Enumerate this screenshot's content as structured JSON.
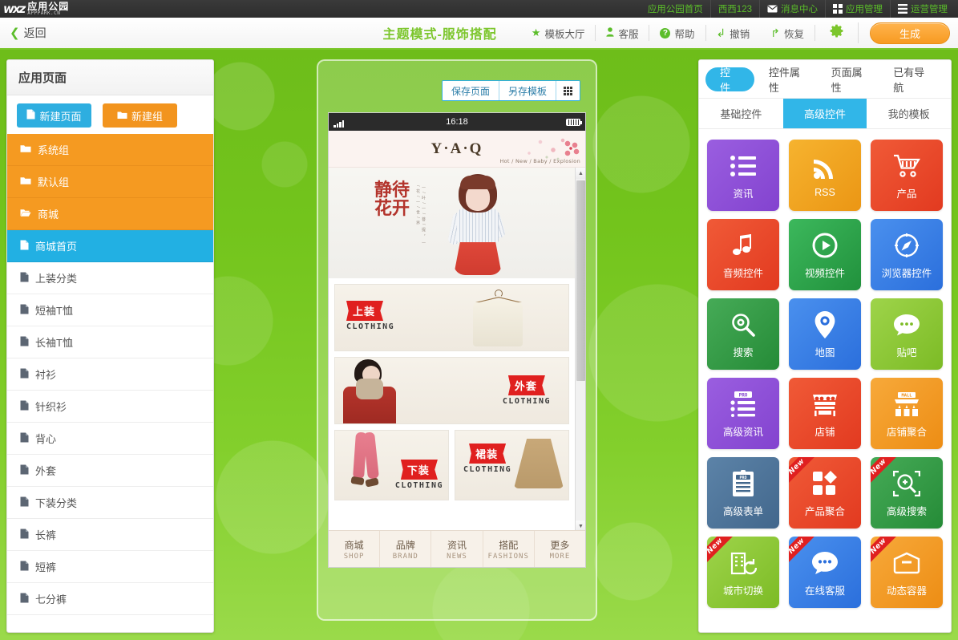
{
  "brand": {
    "mark": "APP",
    "cn": "应用公园",
    "en": "APPPARK.CN"
  },
  "topnav": [
    {
      "label": "应用公园首页",
      "icon": "home-icon"
    },
    {
      "label": "西西123",
      "icon": "user-icon"
    },
    {
      "label": "消息中心",
      "icon": "envelope-icon"
    },
    {
      "label": "应用管理",
      "icon": "grid-icon"
    },
    {
      "label": "运营管理",
      "icon": "list-icon"
    }
  ],
  "toolbar": {
    "back_label": "返回",
    "title": "主题模式-服饰搭配",
    "items": [
      {
        "label": "模板大厅",
        "icon": "star-icon"
      },
      {
        "label": "客服",
        "icon": "user-icon"
      },
      {
        "label": "帮助",
        "icon": "question-icon"
      },
      {
        "label": "撤销",
        "icon": "undo-icon"
      },
      {
        "label": "恢复",
        "icon": "redo-icon"
      }
    ],
    "settings_icon": "gear-icon",
    "generate_label": "生成"
  },
  "sidebar": {
    "title": "应用页面",
    "new_page_label": "新建页面",
    "new_group_label": "新建组",
    "rows": [
      {
        "label": "系统组",
        "type": "group",
        "icon": "folder-icon",
        "active": false
      },
      {
        "label": "默认组",
        "type": "group",
        "icon": "folder-icon",
        "active": false
      },
      {
        "label": "商城",
        "type": "group",
        "icon": "folder-open-icon",
        "active": false
      },
      {
        "label": "商城首页",
        "type": "page",
        "icon": "file-icon",
        "active": true
      },
      {
        "label": "上装分类",
        "type": "page",
        "icon": "file-icon",
        "active": false
      },
      {
        "label": "短袖T恤",
        "type": "page",
        "icon": "file-icon",
        "active": false
      },
      {
        "label": "长袖T恤",
        "type": "page",
        "icon": "file-icon",
        "active": false
      },
      {
        "label": "衬衫",
        "type": "page",
        "icon": "file-icon",
        "active": false
      },
      {
        "label": "针织衫",
        "type": "page",
        "icon": "file-icon",
        "active": false
      },
      {
        "label": "背心",
        "type": "page",
        "icon": "file-icon",
        "active": false
      },
      {
        "label": "外套",
        "type": "page",
        "icon": "file-icon",
        "active": false
      },
      {
        "label": "下装分类",
        "type": "page",
        "icon": "file-icon",
        "active": false
      },
      {
        "label": "长裤",
        "type": "page",
        "icon": "file-icon",
        "active": false
      },
      {
        "label": "短裤",
        "type": "page",
        "icon": "file-icon",
        "active": false
      },
      {
        "label": "七分裤",
        "type": "page",
        "icon": "file-icon",
        "active": false
      }
    ]
  },
  "preview": {
    "save_page_label": "保存页面",
    "save_template_label": "另存模板",
    "qr_icon": "qr-code-icon",
    "status_time": "16:18",
    "app_logo": "Y·A·Q",
    "app_tagline": "Hot / New / Baby / Explosion",
    "hero_title": "静待花开",
    "hero_sub": "一 / 叶 / 一 / 菩 / 提 ， 一 / 花 / 一 / 世 / 界",
    "banners": [
      {
        "tag_cn": "上装",
        "tag_en": "CLOTHING",
        "art": "shirt-hanger",
        "side": "left"
      },
      {
        "tag_cn": "外套",
        "tag_en": "CLOTHING",
        "art": "coat-girl",
        "side": "right"
      }
    ],
    "half_banners": [
      {
        "tag_cn": "下装",
        "tag_en": "CLOTHING",
        "art": "pink-pants",
        "side": "right"
      },
      {
        "tag_cn": "裙装",
        "tag_en": "CLOTHING",
        "art": "khaki-skirt",
        "side": "left"
      }
    ],
    "nav": [
      {
        "cn": "商城",
        "en": "SHOP"
      },
      {
        "cn": "品牌",
        "en": "BRAND"
      },
      {
        "cn": "资讯",
        "en": "NEWS"
      },
      {
        "cn": "搭配",
        "en": "FASHIONS"
      },
      {
        "cn": "更多",
        "en": "MORE"
      }
    ]
  },
  "rightpanel": {
    "tabs": [
      {
        "label": "控件",
        "active": true
      },
      {
        "label": "控件属性",
        "active": false
      },
      {
        "label": "页面属性",
        "active": false
      },
      {
        "label": "已有导航",
        "active": false
      }
    ],
    "subtabs": [
      {
        "label": "基础控件",
        "active": false
      },
      {
        "label": "高级控件",
        "active": true
      },
      {
        "label": "我的模板",
        "active": false
      }
    ],
    "new_badge_label": "New",
    "widgets": [
      {
        "label": "资讯",
        "icon": "news-list-icon",
        "color": "#8b4fd4",
        "new": false
      },
      {
        "label": "RSS",
        "icon": "rss-icon",
        "color": "#f0a41e",
        "new": false
      },
      {
        "label": "产品",
        "icon": "cart-icon",
        "color": "#e8442a",
        "new": false
      },
      {
        "label": "音频控件",
        "icon": "music-note-icon",
        "color": "#e8442a",
        "new": false
      },
      {
        "label": "视频控件",
        "icon": "play-circle-icon",
        "color": "#27a345",
        "new": false
      },
      {
        "label": "浏览器控件",
        "icon": "compass-icon",
        "color": "#2f7fe8",
        "new": false
      },
      {
        "label": "搜索",
        "icon": "magnifier-icon",
        "color": "#2f9e44",
        "new": false
      },
      {
        "label": "地图",
        "icon": "map-pin-icon",
        "color": "#2f7fe8",
        "new": false
      },
      {
        "label": "贴吧",
        "icon": "chat-bubble-icon",
        "color": "#8bc734",
        "new": false
      },
      {
        "label": "高级资讯",
        "icon": "pro-list-icon",
        "color": "#8b4fd4",
        "new": false
      },
      {
        "label": "店铺",
        "icon": "shop-icon",
        "color": "#e8442a",
        "new": false
      },
      {
        "label": "店铺聚合",
        "icon": "mall-icon",
        "color": "#f0982a",
        "new": false
      },
      {
        "label": "高级表单",
        "icon": "pro-clipboard-icon",
        "color": "#4b7296",
        "new": false
      },
      {
        "label": "产品聚合",
        "icon": "tiles-icon",
        "color": "#e8442a",
        "new": true
      },
      {
        "label": "高级搜索",
        "icon": "zoom-in-icon",
        "color": "#2f9e44",
        "new": true
      },
      {
        "label": "城市切换",
        "icon": "city-switch-icon",
        "color": "#8bc734",
        "new": true
      },
      {
        "label": "在线客服",
        "icon": "chat-support-icon",
        "color": "#2f7fe8",
        "new": true
      },
      {
        "label": "动态容器",
        "icon": "container-icon",
        "color": "#f0982a",
        "new": true
      }
    ]
  },
  "colors": {
    "page_bg": "#74c41d",
    "accent_blue": "#31b6e8",
    "accent_orange": "#f2941e",
    "dark_bar": "#2d2d2d",
    "green_text": "#5bbd2a"
  }
}
